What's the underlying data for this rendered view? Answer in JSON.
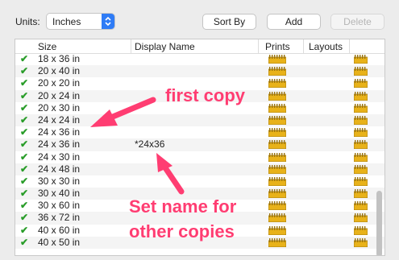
{
  "toolbar": {
    "units_label": "Units:",
    "units_value": "Inches",
    "sort_label": "Sort By",
    "add_label": "Add",
    "delete_label": "Delete"
  },
  "table": {
    "headers": {
      "size": "Size",
      "display": "Display Name",
      "prints": "Prints",
      "layouts": "Layouts"
    },
    "rows": [
      {
        "size": "18 x 36 in",
        "display": ""
      },
      {
        "size": "20 x 40 in",
        "display": ""
      },
      {
        "size": "20 x 20 in",
        "display": ""
      },
      {
        "size": "20 x 24 in",
        "display": ""
      },
      {
        "size": "20 x 30 in",
        "display": ""
      },
      {
        "size": "24 x 24 in",
        "display": ""
      },
      {
        "size": "24 x 36 in",
        "display": ""
      },
      {
        "size": "24 x 36 in",
        "display": "*24x36"
      },
      {
        "size": "24 x 30 in",
        "display": ""
      },
      {
        "size": "24 x 48 in",
        "display": ""
      },
      {
        "size": "30 x 30 in",
        "display": ""
      },
      {
        "size": "30 x 40 in",
        "display": ""
      },
      {
        "size": "30 x 60 in",
        "display": ""
      },
      {
        "size": "36 x 72 in",
        "display": ""
      },
      {
        "size": "40 x 60 in",
        "display": ""
      },
      {
        "size": "40 x 50 in",
        "display": ""
      }
    ]
  },
  "annotations": {
    "first": "first copy",
    "set_line1": "Set name for",
    "set_line2": "other copies"
  },
  "colors": {
    "accent": "#2f7cf6",
    "annotation": "#ff3d72",
    "check": "#2a9d2a",
    "icon": "#e8b21a"
  }
}
